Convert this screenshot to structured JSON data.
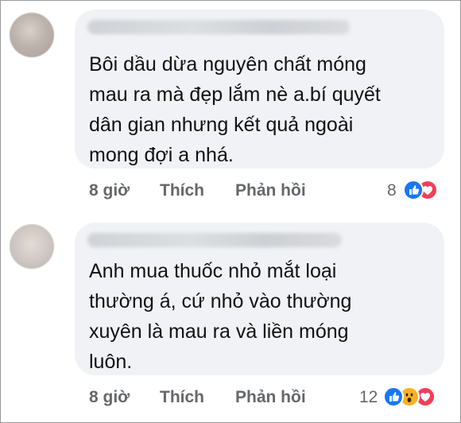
{
  "comments": [
    {
      "text": "Bôi dầu dừa nguyên chất móng\nmau ra mà đẹp lắm nè a.bí quyết\ndân gian nhưng kết quả ngoài\nmong đợi a nhá.",
      "time": "8 giờ",
      "like_label": "Thích",
      "reply_label": "Phản hồi",
      "reaction_count": "8",
      "reactions": [
        "like-icon",
        "love-icon"
      ]
    },
    {
      "text": "Anh mua thuốc nhỏ mắt loại\nthường á, cứ nhỏ vào thường\nxuyên là mau ra và liền móng\nluôn.",
      "time": "8 giờ",
      "like_label": "Thích",
      "reply_label": "Phản hồi",
      "reaction_count": "12",
      "reactions": [
        "like-icon",
        "wow-icon",
        "love-icon"
      ]
    }
  ],
  "colors": {
    "bubble": "#f0f2f5",
    "meta_text": "#65676b",
    "like": "#1877f2",
    "love": "#f33e58",
    "wow": "#f7b125"
  }
}
